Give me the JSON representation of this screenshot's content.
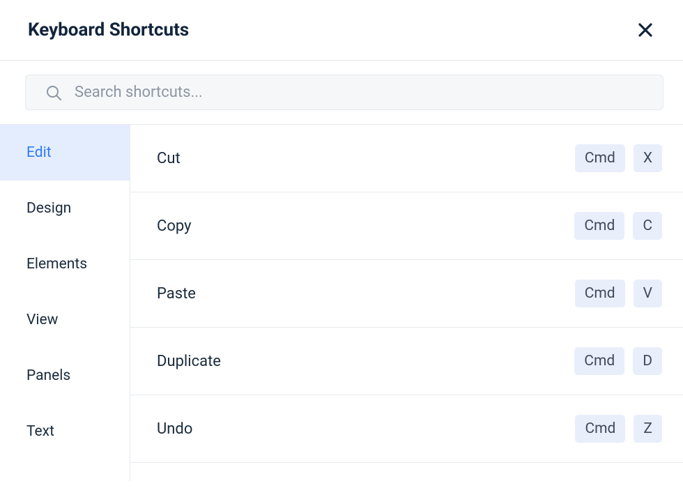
{
  "header": {
    "title": "Keyboard Shortcuts"
  },
  "search": {
    "placeholder": "Search shortcuts..."
  },
  "sidebar": {
    "items": [
      {
        "label": "Edit",
        "active": true
      },
      {
        "label": "Design",
        "active": false
      },
      {
        "label": "Elements",
        "active": false
      },
      {
        "label": "View",
        "active": false
      },
      {
        "label": "Panels",
        "active": false
      },
      {
        "label": "Text",
        "active": false
      }
    ]
  },
  "shortcuts": [
    {
      "label": "Cut",
      "keys": [
        "Cmd",
        "X"
      ]
    },
    {
      "label": "Copy",
      "keys": [
        "Cmd",
        "C"
      ]
    },
    {
      "label": "Paste",
      "keys": [
        "Cmd",
        "V"
      ]
    },
    {
      "label": "Duplicate",
      "keys": [
        "Cmd",
        "D"
      ]
    },
    {
      "label": "Undo",
      "keys": [
        "Cmd",
        "Z"
      ]
    }
  ]
}
